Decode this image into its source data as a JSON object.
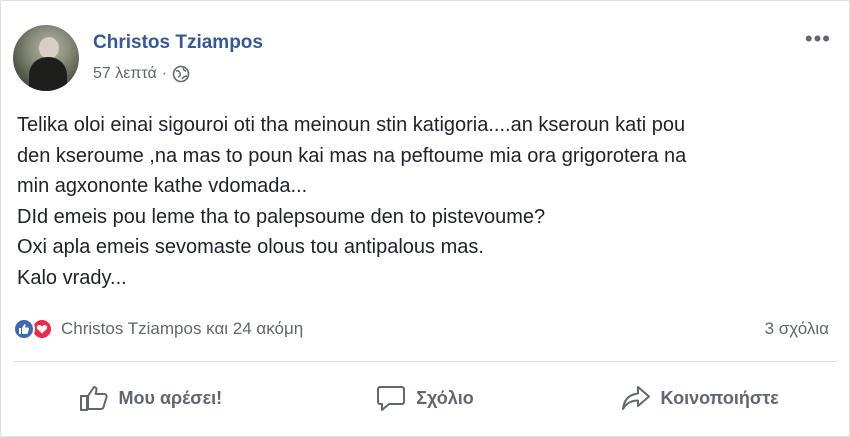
{
  "post": {
    "author": "Christos Tziampos",
    "time": "57 λεπτά",
    "separator": "·",
    "privacy_icon": "globe-icon",
    "menu_icon": "more-options-icon",
    "text_lines": [
      "Telika oloi einai sigouroi oti tha meinoun stin katigoria....an kseroun kati pou",
      "den kseroume ,na mas to poun kai mas na peftoume mia ora grigorotera na",
      "min agxononte kathe vdomada...",
      "DId emeis pou leme tha to palepsoume den to pistevoume?",
      "Oxi apla emeis sevomaste olous tou antipalous mas.",
      "Kalo vrady..."
    ]
  },
  "reactions": {
    "summary": "Christos Tziampos και 24 ακόμη",
    "icons": [
      "like-icon",
      "love-icon"
    ],
    "comments": "3 σχόλια"
  },
  "actions": {
    "like": "Μου αρέσει!",
    "comment": "Σχόλιο",
    "share": "Κοινοποιήστε"
  },
  "colors": {
    "author": "#365899",
    "secondary_text": "#616770",
    "like": "#4267b2",
    "love": "#f0284a"
  }
}
